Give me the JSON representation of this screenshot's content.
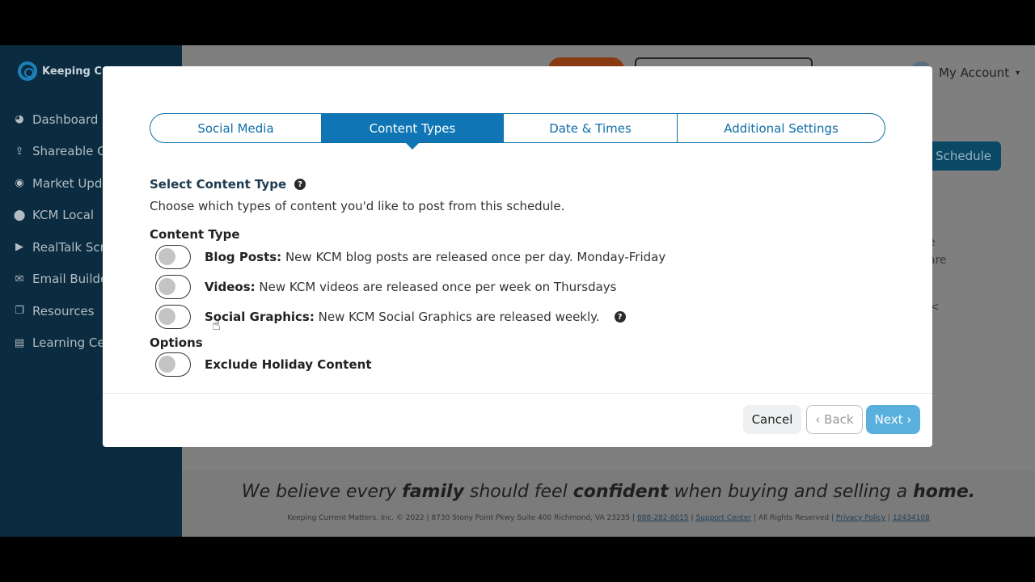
{
  "app": {
    "brand": "Keeping Curr",
    "nav": [
      {
        "label": "Dashboard",
        "icon": "palette-icon"
      },
      {
        "label": "Shareable C",
        "icon": "upload-icon"
      },
      {
        "label": "Market Upda",
        "icon": "broadcast-icon"
      },
      {
        "label": "KCM Local",
        "icon": "map-pin-icon"
      },
      {
        "label": "RealTalk Scri",
        "icon": "play-circle-icon"
      },
      {
        "label": "Email Builder",
        "icon": "envelope-icon"
      },
      {
        "label": "Resources",
        "icon": "copy-icon"
      },
      {
        "label": "Learning Cen",
        "icon": "book-icon"
      }
    ],
    "account_label": "My Account",
    "schedule_button": "Schedule",
    "bg_fragments": [
      "e",
      "are",
      "<"
    ],
    "tagline": {
      "p1": "We believe every ",
      "b1": "family",
      "p2": " should feel ",
      "b2": "confident",
      "p3": " when buying and selling a ",
      "b3": "home."
    },
    "footer": {
      "text": "Keeping Current Matters, Inc. © 2022 | 8730 Stony Point Pkwy Suite 400 Richmond, VA 23235 |",
      "phone": "888-282-8015",
      "support": "Support Center",
      "rights": "| All Rights Reserved |",
      "privacy": "Privacy Policy",
      "id": "12434108"
    }
  },
  "modal": {
    "steps": [
      "Social Media",
      "Content Types",
      "Date & Times",
      "Additional Settings"
    ],
    "active_step": 1,
    "section_title": "Select Content Type",
    "section_subtitle": "Choose which types of content you'd like to post from this schedule.",
    "content_type_label": "Content Type",
    "content_types": [
      {
        "name": "Blog Posts:",
        "desc": "New KCM blog posts are released once per day. Monday-Friday",
        "enabled": false
      },
      {
        "name": "Videos:",
        "desc": "New KCM videos are released once per week on Thursdays",
        "enabled": false
      },
      {
        "name": "Social Graphics:",
        "desc": "New KCM Social Graphics are released weekly.",
        "enabled": false
      }
    ],
    "options_label": "Options",
    "options": [
      {
        "name": "Exclude Holiday Content",
        "enabled": false
      }
    ],
    "buttons": {
      "cancel": "Cancel",
      "back": "‹ Back",
      "next": "Next ›"
    }
  }
}
